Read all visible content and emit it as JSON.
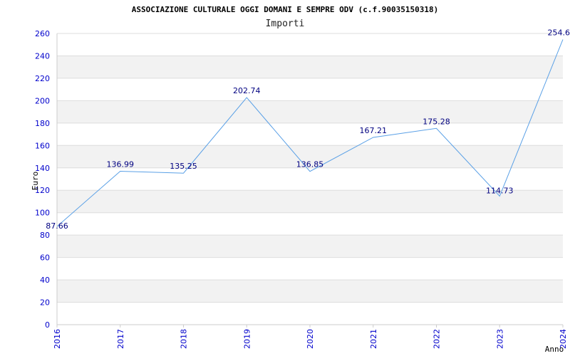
{
  "chart_data": {
    "type": "line",
    "title": "ASSOCIAZIONE CULTURALE OGGI DOMANI E SEMPRE ODV (c.f.90035150318)",
    "subtitle": "Importi",
    "xlabel": "Anno",
    "ylabel": "Euro",
    "x": [
      "2016",
      "2017",
      "2018",
      "2019",
      "2020",
      "2021",
      "2022",
      "2023",
      "2024"
    ],
    "series": [
      {
        "values": [
          87.66,
          136.99,
          135.25,
          202.74,
          136.85,
          167.21,
          175.28,
          114.73,
          254.6
        ],
        "labels": [
          "87.66",
          "136.99",
          "135.25",
          "202.74",
          "136.85",
          "167.21",
          "175.28",
          "114.73",
          "254.6"
        ]
      }
    ],
    "ylim": [
      0,
      260
    ],
    "yticks": [
      0,
      20,
      40,
      60,
      80,
      100,
      120,
      140,
      160,
      180,
      200,
      220,
      240,
      260
    ],
    "grid": "horizontal alternating bands",
    "colors": {
      "line": "#5aa0e6",
      "band": "#f2f2f2",
      "grid": "#dddddd",
      "tick_text": "#0000cc",
      "label_text": "#000080"
    }
  }
}
